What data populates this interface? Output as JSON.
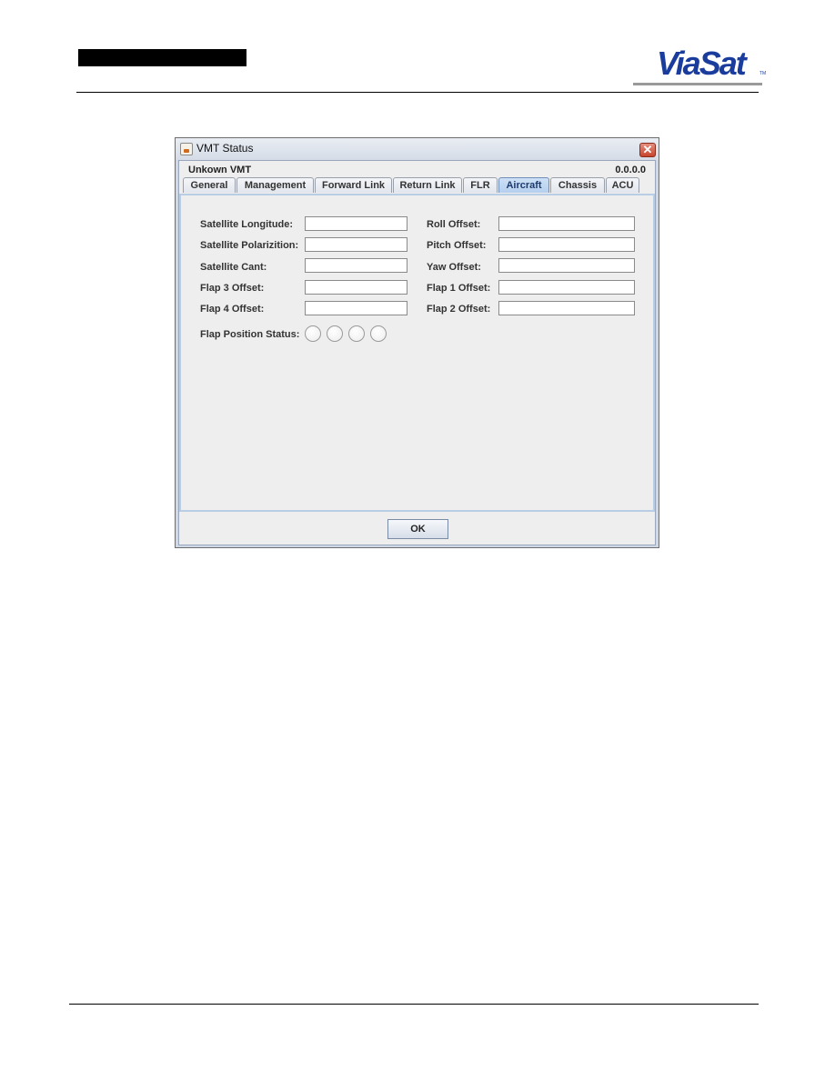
{
  "page": {
    "redacted_header": "",
    "logo_text": "ViaSat",
    "logo_tm": "TM"
  },
  "window": {
    "title": "VMT Status",
    "close_symbol": "✕",
    "vmt_name": "Unkown VMT",
    "vmt_version": "0.0.0.0",
    "tabs": [
      {
        "label": "General",
        "active": false
      },
      {
        "label": "Management",
        "active": false
      },
      {
        "label": "Forward Link",
        "active": false
      },
      {
        "label": "Return Link",
        "active": false
      },
      {
        "label": "FLR",
        "active": false
      },
      {
        "label": "Aircraft",
        "active": true
      },
      {
        "label": "Chassis",
        "active": false
      },
      {
        "label": "ACU",
        "active": false
      }
    ],
    "left_fields": [
      {
        "label": "Satellite Longitude:",
        "value": ""
      },
      {
        "label": "Satellite Polarizition:",
        "value": ""
      },
      {
        "label": "Satellite Cant:",
        "value": ""
      },
      {
        "label": "Flap 3 Offset:",
        "value": ""
      },
      {
        "label": "Flap 4 Offset:",
        "value": ""
      }
    ],
    "right_fields": [
      {
        "label": "Roll Offset:",
        "value": ""
      },
      {
        "label": "Pitch Offset:",
        "value": ""
      },
      {
        "label": "Yaw Offset:",
        "value": ""
      },
      {
        "label": "Flap 1 Offset:",
        "value": ""
      },
      {
        "label": "Flap 2 Offset:",
        "value": ""
      }
    ],
    "flap_status_label": "Flap Position Status:",
    "flap_status_indicators": [
      "off",
      "off",
      "off",
      "off"
    ],
    "ok_label": "OK"
  }
}
